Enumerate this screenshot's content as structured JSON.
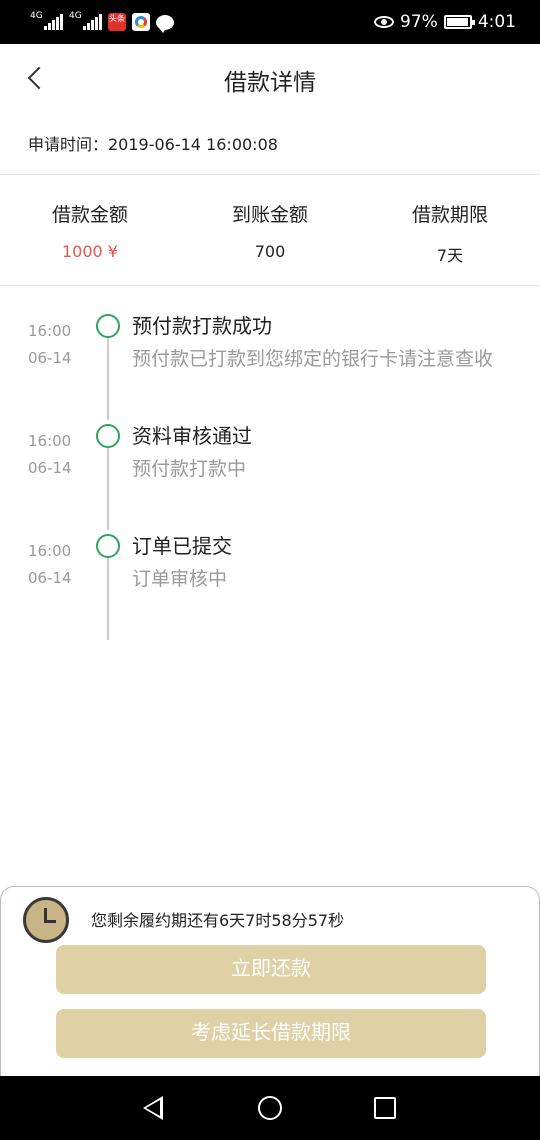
{
  "status_bar": {
    "signal_1": "4G",
    "signal_2": "4G",
    "app_badge": "头条",
    "battery": "97%",
    "time": "4:01"
  },
  "header": {
    "title": "借款详情"
  },
  "apply_time": "申请时间：2019-06-14 16:00:08",
  "summary": [
    {
      "label": "借款金额",
      "value": "1000 ¥"
    },
    {
      "label": "到账金额",
      "value": "700"
    },
    {
      "label": "借款期限",
      "value": "7天"
    }
  ],
  "timeline": [
    {
      "time": "16:00",
      "date": "06-14",
      "title": "预付款打款成功",
      "desc": "预付款已打款到您绑定的银行卡请注意查收"
    },
    {
      "time": "16:00",
      "date": "06-14",
      "title": "资料审核通过",
      "desc": "预付款打款中"
    },
    {
      "time": "16:00",
      "date": "06-14",
      "title": "订单已提交",
      "desc": "订单审核中"
    }
  ],
  "bottom": {
    "countdown": "您剩余履约期还有6天7时58分57秒",
    "repay_label": "立即还款",
    "extend_label": "考虑延长借款期限"
  },
  "colors": {
    "accent_gold": "#dfd0a6",
    "amount_red": "#e8534b",
    "timeline_green": "#2fa45c"
  },
  "battery_level": 0.97
}
